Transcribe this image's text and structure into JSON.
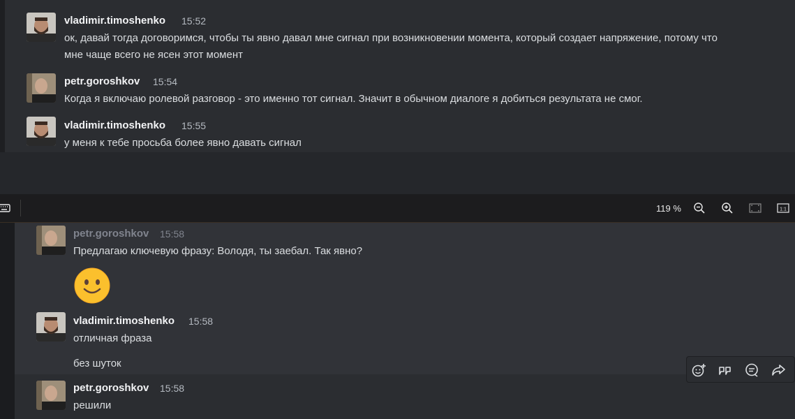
{
  "top_messages": [
    {
      "user": "vladimir.timoshenko",
      "time": "15:52",
      "lines": [
        "ок, давай тогда договоримся, чтобы ты явно давал мне сигнал при возникновении момента, который создает напряжение, потому что",
        "мне чаще всего не ясен этот момент"
      ]
    },
    {
      "user": "petr.goroshkov",
      "time": "15:54",
      "lines": [
        "Когда я включаю ролевой разговор - это именно тот сигнал. Значит в обычном диалоге я добиться результата не смог."
      ]
    },
    {
      "user": "vladimir.timoshenko",
      "time": "15:55",
      "lines": [
        "у меня к тебе просьба более явно давать сигнал"
      ]
    }
  ],
  "toolbar": {
    "zoom": "119 %",
    "actual_size": "1:1"
  },
  "bottom_messages": [
    {
      "user": "petr.goroshkov",
      "time": "15:58",
      "lines": [
        "Предлагаю ключевую фразу: Володя, ты заебал. Так явно?"
      ],
      "emoji": "slightly-smiling-face"
    },
    {
      "user": "vladimir.timoshenko",
      "time": "15:58",
      "lines": [
        "отличная фраза",
        "без шуток"
      ]
    },
    {
      "user": "petr.goroshkov",
      "time": "15:58",
      "lines": [
        "решили"
      ]
    }
  ],
  "message_actions": [
    "add-reaction-icon",
    "quote-icon",
    "reply-icon",
    "forward-icon"
  ]
}
